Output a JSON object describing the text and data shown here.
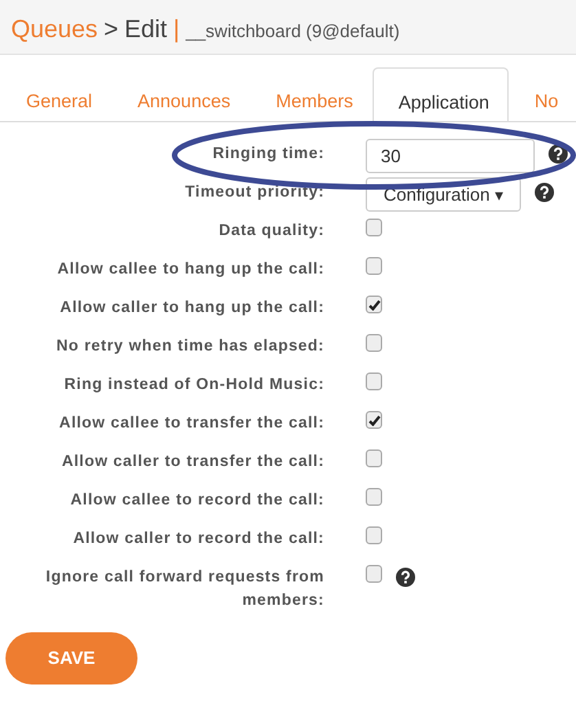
{
  "breadcrumb": {
    "section": "Queues",
    "separator": ">",
    "page": "Edit",
    "divider": "|",
    "record": "__switchboard (9@default)"
  },
  "tabs": [
    {
      "label": "General",
      "selected": false
    },
    {
      "label": "Announces",
      "selected": false
    },
    {
      "label": "Members",
      "selected": false
    },
    {
      "label": "Application",
      "selected": true
    },
    {
      "label": "No",
      "selected": false
    }
  ],
  "fields": [
    {
      "kind": "text",
      "label": "Ringing time:",
      "value": "30",
      "help": true,
      "highlighted": true
    },
    {
      "kind": "select",
      "label": "Timeout priority:",
      "value": "Configuration",
      "caret": "▾",
      "help": true,
      "highlighted": false
    },
    {
      "kind": "checkbox",
      "label": "Data quality:",
      "checked": false,
      "help": false,
      "highlighted": false
    },
    {
      "kind": "checkbox",
      "label": "Allow callee to hang up the call:",
      "checked": false,
      "help": false,
      "highlighted": false
    },
    {
      "kind": "checkbox",
      "label": "Allow caller to hang up the call:",
      "checked": true,
      "help": false,
      "highlighted": false
    },
    {
      "kind": "checkbox",
      "label": "No retry when time has elapsed:",
      "checked": false,
      "help": false,
      "highlighted": false
    },
    {
      "kind": "checkbox",
      "label": "Ring instead of On-Hold Music:",
      "checked": false,
      "help": false,
      "highlighted": false
    },
    {
      "kind": "checkbox",
      "label": "Allow callee to transfer the call:",
      "checked": true,
      "help": false,
      "highlighted": false
    },
    {
      "kind": "checkbox",
      "label": "Allow caller to transfer the call:",
      "checked": false,
      "help": false,
      "highlighted": false
    },
    {
      "kind": "checkbox",
      "label": "Allow callee to record the call:",
      "checked": false,
      "help": false,
      "highlighted": false
    },
    {
      "kind": "checkbox",
      "label": "Allow caller to record the call:",
      "checked": false,
      "help": false,
      "highlighted": false
    },
    {
      "kind": "checkbox",
      "label": "Ignore call forward requests from members:",
      "checked": false,
      "help": true,
      "highlighted": false
    }
  ],
  "save_button": "SAVE"
}
